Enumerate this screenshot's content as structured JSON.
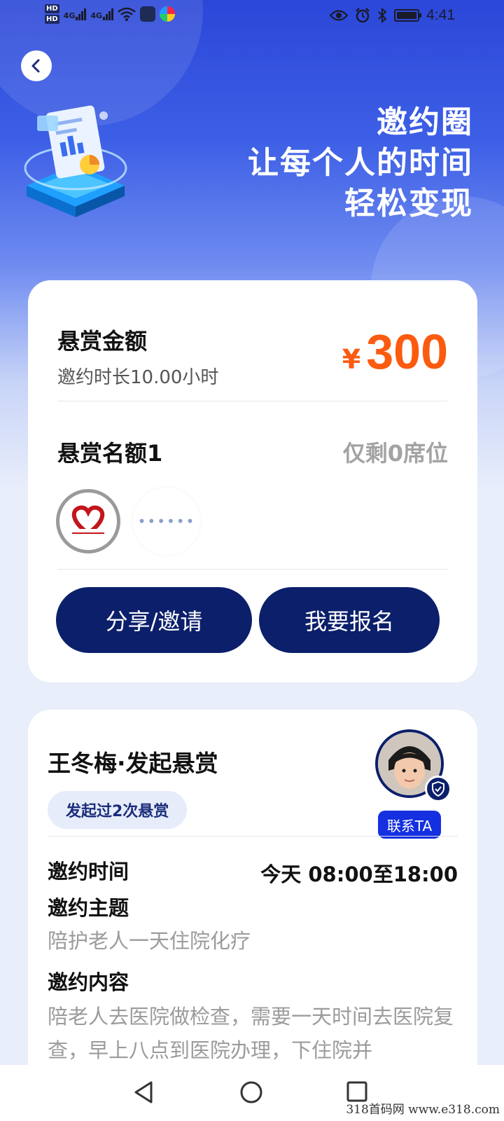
{
  "status_bar": {
    "network_labels": [
      "4G",
      "4G"
    ],
    "hd_labels": [
      "HD",
      "HD"
    ],
    "time": "4:41"
  },
  "hero": {
    "slogan_lines": [
      "邀约圈",
      "让每个人的时间",
      "轻松变现"
    ]
  },
  "reward_card": {
    "amount_title": "悬赏金额",
    "duration_text": "邀约时长10.00小时",
    "currency_symbol": "¥",
    "amount_value": "300",
    "quota_title": "悬赏名额1",
    "quota_remaining": "仅剩0席位",
    "more_dots": "••••••",
    "share_button": "分享/邀请",
    "join_button": "我要报名"
  },
  "host_card": {
    "title": "王冬梅·发起悬赏",
    "badge": "发起过2次悬赏",
    "contact_button": "联系TA",
    "time_label": "邀约时间",
    "time_value": "今天 08:00至18:00",
    "topic_label": "邀约主题",
    "topic_value": "陪护老人一天住院化疗",
    "content_label": "邀约内容",
    "content_value": "陪老人去医院做检查，需要一天时间去医院复查，早上八点到医院办理，下住院并"
  },
  "colors": {
    "accent_orange": "#fb5b10",
    "button_navy": "#0b1f6b",
    "contact_blue": "#1430e0"
  },
  "watermark": "318首码网 www.e318.com"
}
